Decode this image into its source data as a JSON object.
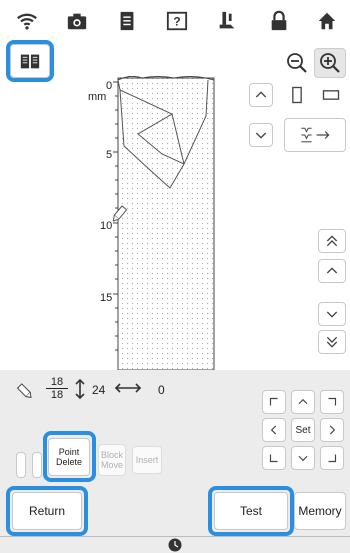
{
  "ruler": {
    "unit": "mm",
    "ticks": [
      "0",
      "5",
      "10",
      "15"
    ]
  },
  "info": {
    "frac_top": "18",
    "frac_bottom": "18",
    "height_value": "24",
    "width_value": "0"
  },
  "buttons": {
    "point_delete_line1": "Point",
    "point_delete_line2": "Delete",
    "block_move_line1": "Block",
    "block_move_line2": "Move",
    "insert": "Insert",
    "set": "Set",
    "return": "Return",
    "test": "Test",
    "memory": "Memory"
  },
  "colors": {
    "highlight": "#2a8fe0",
    "panel": "#ececec"
  }
}
